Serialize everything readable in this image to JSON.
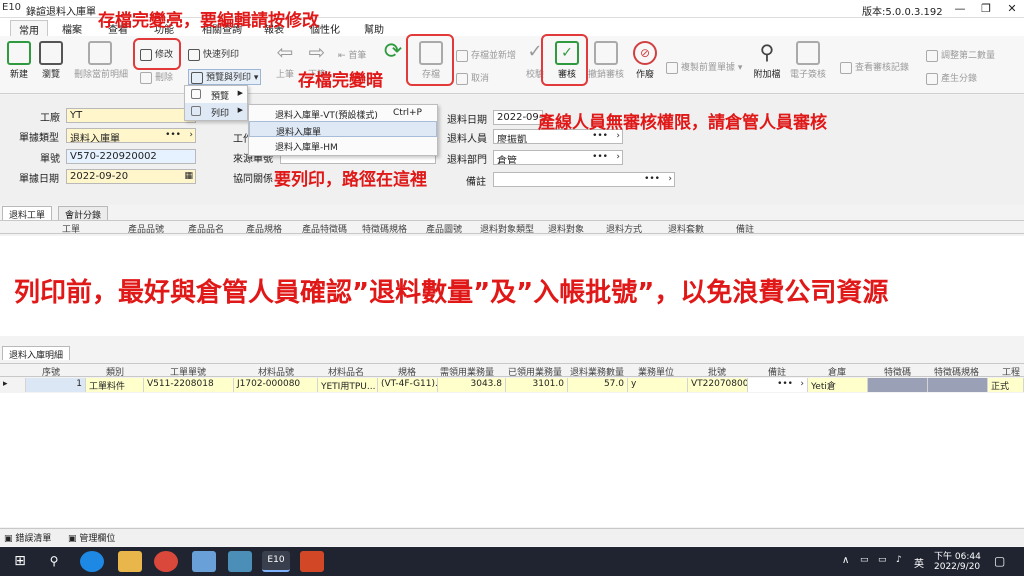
{
  "window": {
    "app_icon": "E10",
    "title": "錄諠退料入庫單",
    "version": "版本:5.0.0.3.192",
    "controls": [
      "—",
      "❐",
      "✕"
    ]
  },
  "menu_tabs": [
    "常用",
    "檔案",
    "查看",
    "功能",
    "相關查詢",
    "報表",
    "個性化",
    "幫助"
  ],
  "toolbar": {
    "new": "新建",
    "browse": "瀏覽",
    "delete_line": "刪除當前明細",
    "modify": "修改",
    "delete": "刪除",
    "quick_print": "快速列印",
    "preview_print": "預覽與列印",
    "prev": "上筆",
    "next": "下筆",
    "first": "首筆",
    "save": "存檔",
    "save_add": "存檔並新增",
    "cancel": "取消",
    "verify": "校驗",
    "approve": "審核",
    "unapprove": "撤銷審核",
    "void": "作廢",
    "copy_prev": "複製前置單據",
    "attach": "附加檔",
    "esign": "電子簽核",
    "view_history": "查看審核記錄",
    "adjust_second_qty": "調整第二數量",
    "generate_entry": "產生分錄"
  },
  "annotations": {
    "top": "存檔完變亮，要編輯請按修改",
    "save_dim": "存檔完變暗",
    "approve": "產線人員無審核權限，請倉管人員審核",
    "print_path": "要列印，路徑在這裡",
    "big": "列印前，最好與倉管人員確認”退料數量”及”入帳批號”，以免浪費公司資源"
  },
  "form": {
    "factory_label": "工廠",
    "factory_value": "YT",
    "doc_type_label": "單據類型",
    "doc_type_value": "退料入庫單",
    "doc_no_label": "單號",
    "doc_no_value": "V570-220920002",
    "doc_date_label": "單據日期",
    "doc_date_value": "2022-09-20",
    "work_label": "工作",
    "source_label": "來源單號",
    "contract_label": "協同關係",
    "return_date_label": "退料日期",
    "return_date_value": "2022-09-20",
    "return_person_label": "退料人員",
    "return_person_value": "廖振凱",
    "return_dept_label": "退料部門",
    "return_dept_value": "倉管",
    "remark_label": "備註",
    "remark_value": ""
  },
  "context_menu": {
    "preview": "預覽",
    "print": "列印",
    "submenu": [
      {
        "label": "退料入庫單-VT(預設樣式)",
        "shortcut": "Ctrl+P"
      },
      {
        "label": "退料入庫單",
        "shortcut": ""
      },
      {
        "label": "退料入庫單-HM",
        "shortcut": ""
      }
    ]
  },
  "upper_tabs": [
    "退料工單",
    "會計分錄"
  ],
  "upper_columns": [
    "工單",
    "產品品號",
    "產品品名",
    "產品規格",
    "產品特徵碼",
    "特徵碼規格",
    "產品圖號",
    "退料對象類型",
    "退料對象",
    "退料方式",
    "退料套數",
    "備註"
  ],
  "lower_tab": "退料入庫明細",
  "lower_columns": [
    "序號",
    "類別",
    "工單單號",
    "材料品號",
    "材料品名",
    "規格",
    "需領用業務量",
    "已領用業務量",
    "退料業務數量",
    "業務單位",
    "批號",
    "備註",
    "倉庫",
    "特徵碼",
    "特徵碼規格",
    "工程"
  ],
  "lower_rows": [
    {
      "arrow": "▸",
      "seq": "1",
      "category": "工單料件",
      "wo": "V511-2208018",
      "mat_no": "J1702-000080",
      "mat_name": "YETI用TPU...",
      "spec": "(VT-4F-G11)...",
      "need_qty": "3043.8",
      "used_qty": "3101.0",
      "return_qty": "57.0",
      "unit": "y",
      "lot": "VT22070800...",
      "remark": "",
      "warehouse": "Yeti倉",
      "feature": "",
      "feature_spec": "",
      "process": "正式"
    }
  ],
  "bottom_tabs": [
    "錯誤清單",
    "管理欄位"
  ],
  "taskbar": {
    "time": "下午 06:44",
    "date": "2022/9/20",
    "ime": "英",
    "app_label": "E10",
    "tray_chevron": "∧"
  },
  "colors": {
    "annotation_red": "#e01818",
    "highlight_yellow": "#fff6cc",
    "taskbar_bg": "#1f2430"
  }
}
